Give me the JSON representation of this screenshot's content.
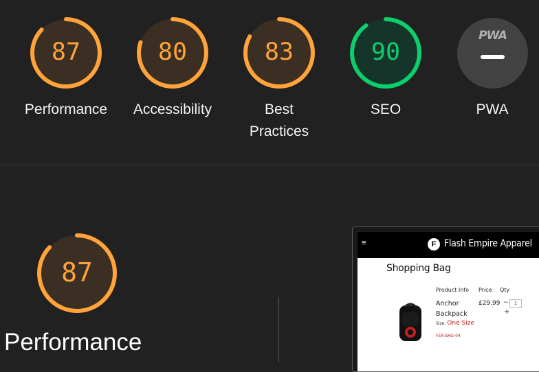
{
  "colors": {
    "orange": "#ffa33a",
    "orange_track": "#4a3620",
    "green": "#0cce6b",
    "green_track": "#133824",
    "bg": "#212121"
  },
  "categories": [
    {
      "score": 87,
      "value": 0.87,
      "label_lines": [
        "Performance"
      ],
      "status": "average"
    },
    {
      "score": 80,
      "value": 0.8,
      "label_lines": [
        "Accessibility"
      ],
      "status": "average"
    },
    {
      "score": 83,
      "value": 0.83,
      "label_lines": [
        "Best",
        "Practices"
      ],
      "status": "average"
    },
    {
      "score": 90,
      "value": 0.9,
      "label_lines": [
        "SEO"
      ],
      "status": "pass"
    }
  ],
  "pwa": {
    "badge_text": "PWA",
    "label": "PWA",
    "icon": "pwa-badge-icon"
  },
  "performance_section": {
    "score": 87,
    "value": 0.87,
    "title": "Performance"
  },
  "screenshot": {
    "menu_icon": "≡",
    "logo_glyph": "F",
    "brand": "Flash Empire Apparel",
    "heading": "Shopping Bag",
    "col_product": "Product Info",
    "col_price": "Price",
    "col_qty": "Qty",
    "product_line1": "Anchor",
    "product_line2": "Backpack",
    "size_label": "Size:",
    "size_value": "One Size",
    "sku": "FEA-BAG-04",
    "price": "£29.99",
    "qty_minus": "−",
    "qty_value": "1",
    "qty_plus": "+"
  }
}
